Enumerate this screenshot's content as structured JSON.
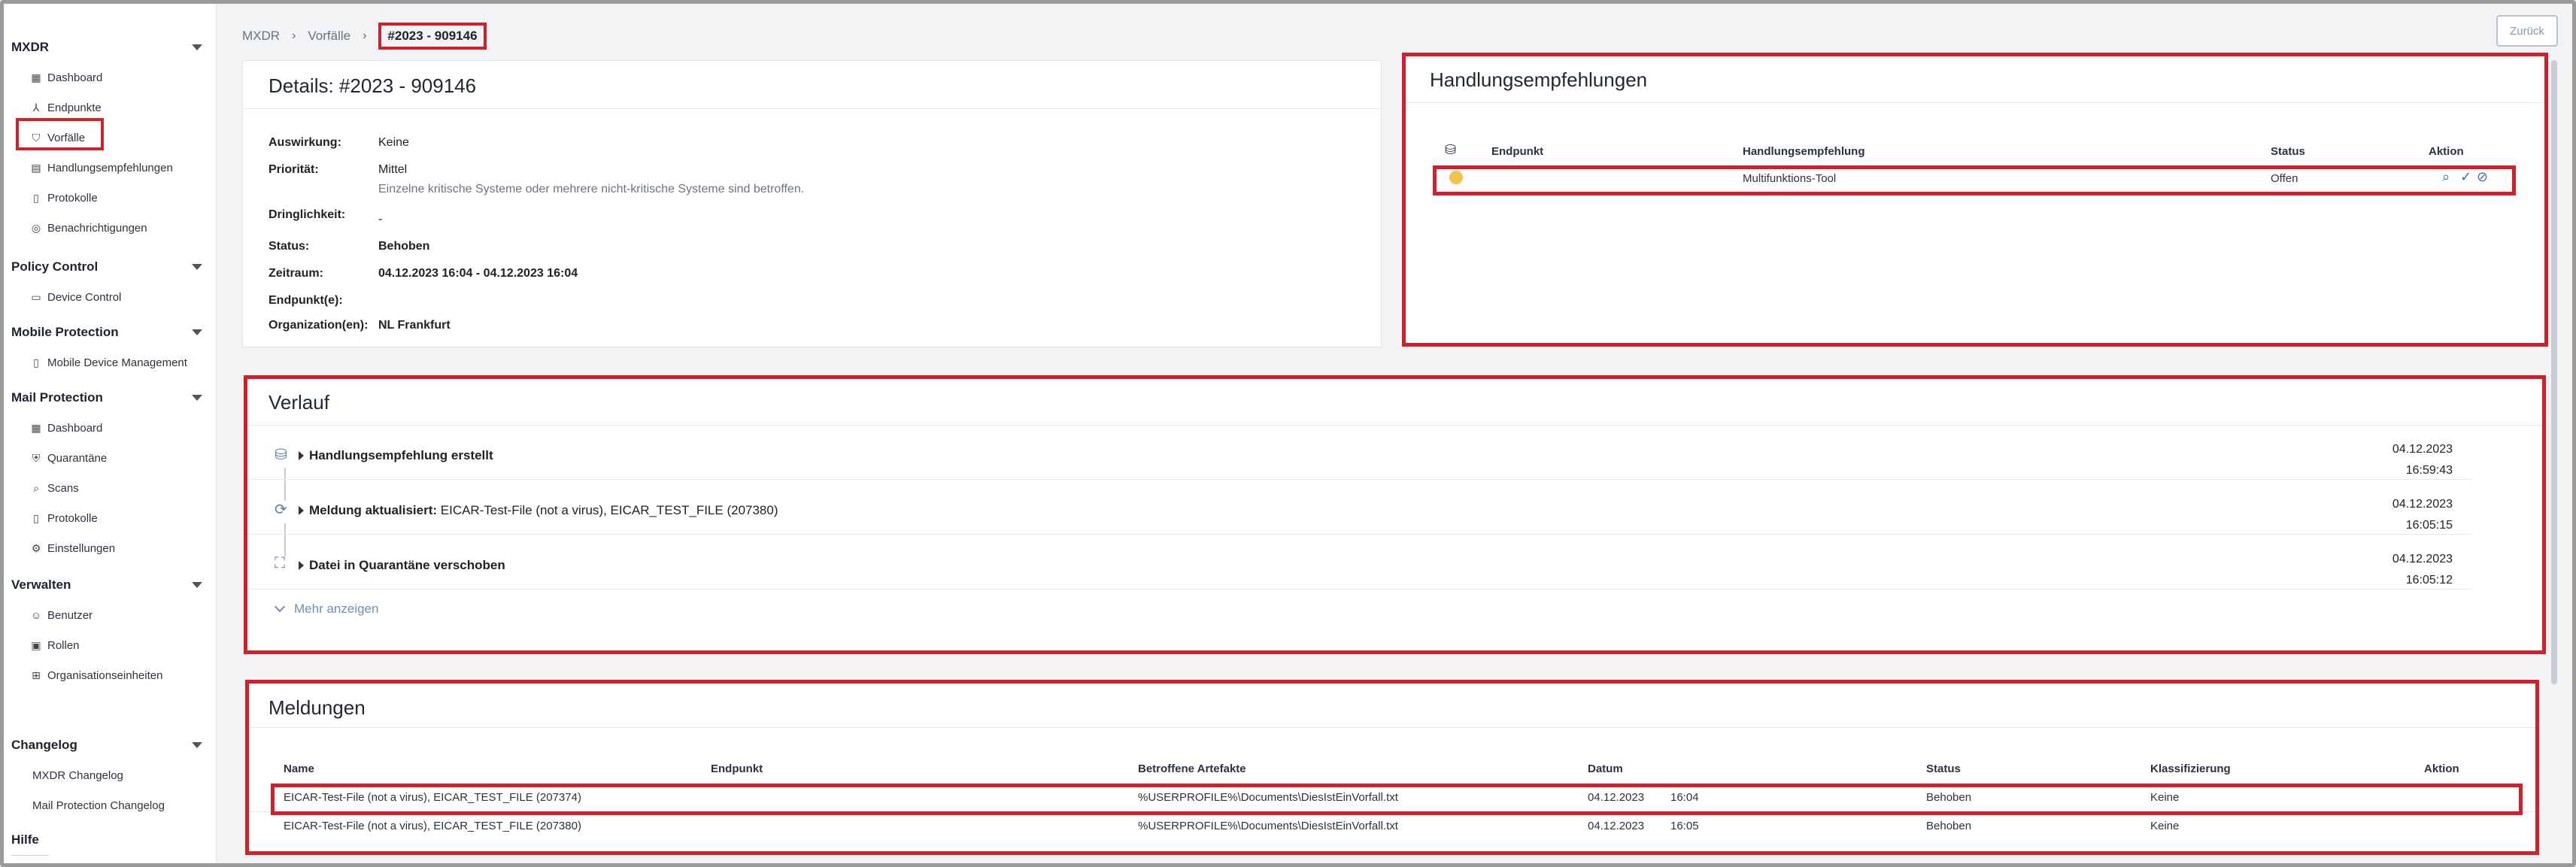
{
  "sidebar": {
    "sections": [
      {
        "title": "MXDR",
        "items": [
          {
            "label": "Dashboard",
            "icon": "dashboard-icon"
          },
          {
            "label": "Endpunkte",
            "icon": "network-icon"
          },
          {
            "label": "Vorfälle",
            "icon": "shield-icon"
          },
          {
            "label": "Handlungsempfehlungen",
            "icon": "list-icon"
          },
          {
            "label": "Protokolle",
            "icon": "document-icon"
          },
          {
            "label": "Benachrichtigungen",
            "icon": "bell-icon"
          }
        ]
      },
      {
        "title": "Policy Control",
        "items": [
          {
            "label": "Device Control",
            "icon": "laptop-icon"
          }
        ]
      },
      {
        "title": "Mobile Protection",
        "items": [
          {
            "label": "Mobile Device Management",
            "icon": "phone-icon"
          }
        ]
      },
      {
        "title": "Mail Protection",
        "items": [
          {
            "label": "Dashboard",
            "icon": "dashboard-icon"
          },
          {
            "label": "Quarantäne",
            "icon": "quarantine-icon"
          },
          {
            "label": "Scans",
            "icon": "scan-icon"
          },
          {
            "label": "Protokolle",
            "icon": "document-icon"
          },
          {
            "label": "Einstellungen",
            "icon": "gear-icon"
          }
        ]
      },
      {
        "title": "Verwalten",
        "items": [
          {
            "label": "Benutzer",
            "icon": "user-icon"
          },
          {
            "label": "Rollen",
            "icon": "roles-icon"
          },
          {
            "label": "Organisationseinheiten",
            "icon": "org-icon"
          }
        ]
      },
      {
        "title": "Changelog",
        "items": [
          {
            "label": "MXDR Changelog",
            "icon": ""
          },
          {
            "label": "Mail Protection Changelog",
            "icon": ""
          }
        ]
      },
      {
        "title": "Hilfe",
        "items": []
      }
    ]
  },
  "breadcrumb": {
    "items": [
      "MXDR",
      "Vorfälle"
    ],
    "current": "#2023 - 909146"
  },
  "back_button": "Zurück",
  "details": {
    "title": "Details: #2023 - 909146",
    "rows": [
      {
        "label": "Auswirkung:",
        "value": "Keine"
      },
      {
        "label": "Priorität:",
        "value": "Mittel",
        "sub": "Einzelne kritische Systeme oder mehrere nicht-kritische Systeme sind betroffen."
      },
      {
        "label": "Dringlichkeit:",
        "value": "-"
      },
      {
        "label": "Status:",
        "value": "Behoben"
      },
      {
        "label": "Zeitraum:",
        "value": "04.12.2023 16:04 - 04.12.2023 16:04"
      },
      {
        "label": "Endpunkt(e):",
        "value": ""
      },
      {
        "label": "Organization(en):",
        "value": "NL Frankfurt"
      }
    ]
  },
  "actions": {
    "title": "Handlungsempfehlungen",
    "headers": {
      "priority": "",
      "endpoint": "Endpunkt",
      "action": "Handlungsempfehlung",
      "status": "Status",
      "aktion": "Aktion"
    },
    "rows": [
      {
        "endpoint": "",
        "action": "Multifunktions-Tool",
        "status": "Offen",
        "dot_color": "#f2c14e"
      }
    ]
  },
  "history": {
    "title": "Verlauf",
    "items": [
      {
        "title_bold": "Handlungsempfehlung erstellt",
        "title_rest": "",
        "date": "04.12.2023",
        "time": "16:59:43",
        "icon": "traffic-light-icon"
      },
      {
        "title_bold": "Meldung aktualisiert:",
        "title_rest": " EICAR-Test-File (not a virus), EICAR_TEST_FILE (207380)",
        "date": "04.12.2023",
        "time": "16:05:15",
        "icon": "refresh-icon"
      },
      {
        "title_bold": "Datei in Quarantäne verschoben",
        "title_rest": "",
        "date": "04.12.2023",
        "time": "16:05:12",
        "icon": "quarantine-file-icon"
      }
    ],
    "more": "Mehr anzeigen"
  },
  "reports": {
    "title": "Meldungen",
    "headers": [
      "Name",
      "Endpunkt",
      "Betroffene Artefakte",
      "Datum",
      "Status",
      "Klassifizierung",
      "Aktion"
    ],
    "rows": [
      {
        "name": "EICAR-Test-File (not a virus), EICAR_TEST_FILE (207374)",
        "endpoint": "",
        "artifact": "%USERPROFILE%\\Documents\\DiesIstEinVorfall.txt",
        "date": "04.12.2023",
        "time": "16:04",
        "status": "Behoben",
        "class": "Keine"
      },
      {
        "name": "EICAR-Test-File (not a virus), EICAR_TEST_FILE (207380)",
        "endpoint": "",
        "artifact": "%USERPROFILE%\\Documents\\DiesIstEinVorfall.txt",
        "date": "04.12.2023",
        "time": "16:05",
        "status": "Behoben",
        "class": "Keine"
      }
    ]
  }
}
